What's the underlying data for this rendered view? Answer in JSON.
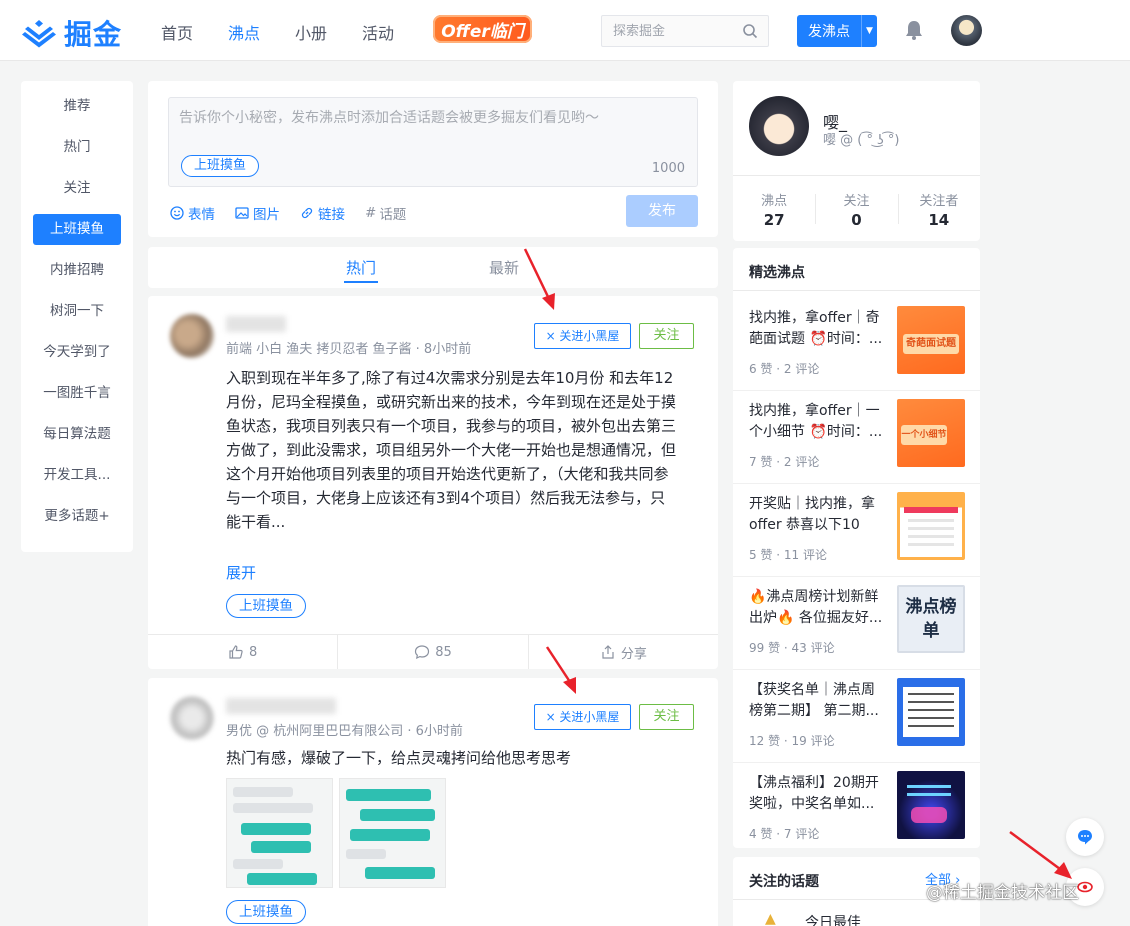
{
  "header": {
    "logo_text": "掘金",
    "nav": [
      "首页",
      "沸点",
      "小册",
      "活动"
    ],
    "active_nav": "沸点",
    "offer_badge": "Offer临门",
    "search_placeholder": "探索掘金",
    "post_button": "发沸点"
  },
  "sidebar": {
    "items": [
      "推荐",
      "热门",
      "关注",
      "上班摸鱼",
      "内推招聘",
      "树洞一下",
      "今天学到了",
      "一图胜千言",
      "每日算法题",
      "开发工具...",
      "更多话题+"
    ],
    "active": "上班摸鱼"
  },
  "composer": {
    "placeholder": "告诉你个小秘密，发布沸点时添加合适话题会被更多掘友们看见哟～",
    "topic": "上班摸鱼",
    "char_count": "1000",
    "tools": [
      "表情",
      "图片",
      "链接",
      "话题"
    ],
    "publish": "发布"
  },
  "feed_tabs": [
    "热门",
    "最新"
  ],
  "posts": [
    {
      "meta": "前端 小白 渔夫 拷贝忍者 鱼子酱 · 8小时前",
      "blacklist_button": "× 关进小黑屋",
      "follow_button": "关注",
      "content": "入职到现在半年多了,除了有过4次需求分别是去年10月份 和去年12月份，尼玛全程摸鱼，或研究新出来的技术，今年到现在还是处于摸鱼状态，我项目列表只有一个项目，我参与的项目，被外包出去第三方做了，到此没需求，项目组另外一个大佬一开始也是想通情况，但这个月开始他项目列表里的项目开始迭代更新了，（大佬和我共同参与一个项目，大佬身上应该还有3到4个项目）然后我无法参与，只能干看...",
      "expand": "展开",
      "topic": "上班摸鱼",
      "likes": "8",
      "comments": "85",
      "share": "分享"
    },
    {
      "meta": "男优 @ 杭州阿里巴巴有限公司 · 6小时前",
      "blacklist_button": "× 关进小黑屋",
      "follow_button": "关注",
      "content": "热门有感，爆破了一下，给点灵魂拷问给他思考思考",
      "topic": "上班摸鱼"
    }
  ],
  "profile": {
    "name": "嘤_",
    "subtitle": "嘤 @ ( ͡° ͜ʖ ͡°)",
    "stats": [
      {
        "label": "沸点",
        "value": "27"
      },
      {
        "label": "关注",
        "value": "0"
      },
      {
        "label": "关注者",
        "value": "14"
      }
    ]
  },
  "picks": {
    "title": "精选沸点",
    "items": [
      {
        "text": "找内推，拿offer｜奇葩面试题 ⏰时间：...",
        "meta": "6 赞 · 2 评论"
      },
      {
        "text": "找内推，拿offer｜一个小细节 ⏰时间：...",
        "meta": "7 赞 · 2 评论"
      },
      {
        "text": "开奖贴｜找内推，拿offer 恭喜以下10位...",
        "meta": "5 赞 · 11 评论"
      },
      {
        "text": "🔥沸点周榜计划新鲜出炉🔥 各位掘友好...",
        "meta": "99 赞 · 43 评论"
      },
      {
        "text": "【获奖名单｜沸点周榜第二期】 第二期...",
        "meta": "12 赞 · 19 评论"
      },
      {
        "text": "【沸点福利】20期开奖啦，中奖名单如...",
        "meta": "4 赞 · 7 评论"
      }
    ],
    "thumb_texts": [
      "奇葩面试题",
      "一个小细节",
      "",
      "沸点榜单",
      "",
      ""
    ]
  },
  "followed_topics": {
    "title": "关注的话题",
    "all": "全部 ›",
    "first_item": "今日最佳"
  },
  "watermark": "@稀土掘金技术社区",
  "colors": {
    "accent": "#1e80ff",
    "follow_green": "#6cbd45",
    "annotation_red": "#e8222b"
  }
}
